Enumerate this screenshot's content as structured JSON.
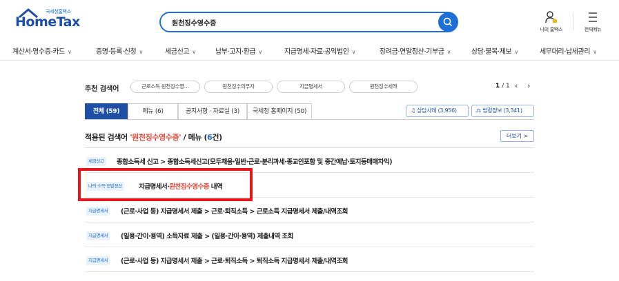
{
  "header": {
    "logo_sub": "국세청홈택스",
    "logo_main": "HomeTax",
    "search_value": "원천징수영수증",
    "my_hometax_label": "나의 홈택스",
    "full_menu_label": "전체메뉴"
  },
  "nav": [
    {
      "label": "계산서·영수증·카드"
    },
    {
      "label": "증명·등록·신청"
    },
    {
      "label": "세금신고"
    },
    {
      "label": "납부·고지·환급"
    },
    {
      "label": "지급명세·자료·공익법인"
    },
    {
      "label": "장려금·연말정산·기부금"
    },
    {
      "label": "상담·불복·제보"
    },
    {
      "label": "세무대리·납세관리"
    }
  ],
  "recommend": {
    "label": "추천 검색어",
    "chips": [
      "근로소득 원천징수영…",
      "원천징수의무자",
      "지급명세서",
      "원천징수세액"
    ],
    "pager_current": "1",
    "pager_total": "/ 1"
  },
  "tabs": [
    {
      "label": "전체 (59)",
      "active": true
    },
    {
      "label": "메뉴 (6)"
    },
    {
      "label": "공지사항 · 자료실 (3)"
    },
    {
      "label": "국세청 홈페이지 (50)"
    }
  ],
  "pills": [
    {
      "label": "상담사례 (3,956)",
      "icon": "headset-icon"
    },
    {
      "label": "법령정보 (3,341)",
      "icon": "gavel-icon"
    }
  ],
  "result_header": {
    "prefix": "적용된 검색어 ",
    "keyword": "'원천징수영수증'",
    "middle": " / 메뉴 (",
    "count": "6",
    "suffix": "건)",
    "more_label": "더보기 >"
  },
  "results": [
    {
      "tag": "세금신고",
      "pre": "종합소득세 신고 > 종합소득세신고(모두채움·일반·근로·분리과세·종교인포함 및 중간예납·토지등매매차익)",
      "kw": "",
      "post": ""
    },
    {
      "tag": "나의 소득·연말정산",
      "pre": "지급명세서·",
      "kw": "원천징수영수증",
      "post": " 내역"
    },
    {
      "tag": "지급명세서",
      "pre": "(근로·사업 등) 지급명세서 제출 > 근로·퇴직소득 > 근로소득 지급명세서 제출/내역조회",
      "kw": "",
      "post": ""
    },
    {
      "tag": "지급명세서",
      "pre": "(일용·간이·용역) 소득자료 제출 > (일용·간이·용역) 제출내역 조회",
      "kw": "",
      "post": ""
    },
    {
      "tag": "지급명세서",
      "pre": "(근로·사업 등) 지급명세서 제출 > 근로·퇴직소득 > 퇴직소득 지급명세서 제출/내역조회",
      "kw": "",
      "post": ""
    }
  ],
  "colors": {
    "primary": "#1f6fd8",
    "tab_active": "#1f4fa5",
    "keyword": "#e14a3b",
    "highlight": "#e8151b"
  }
}
